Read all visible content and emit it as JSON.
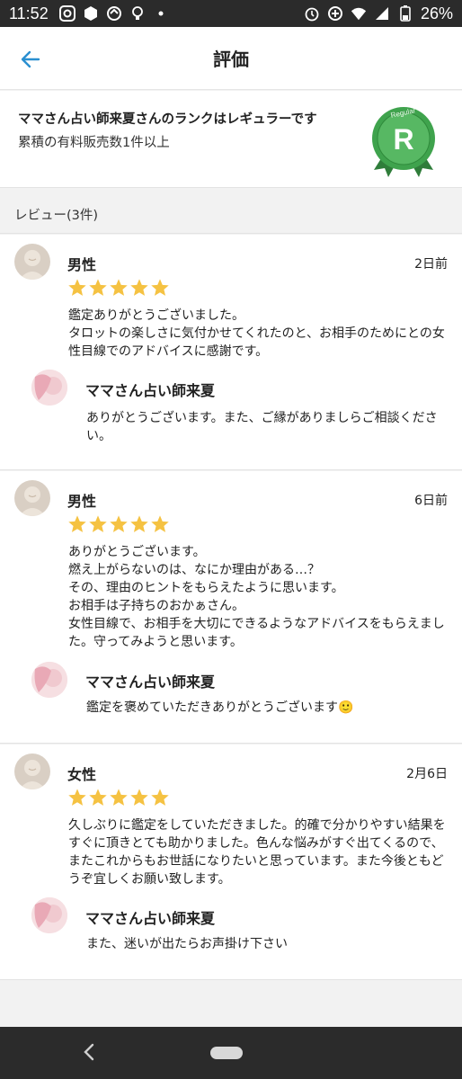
{
  "status_bar": {
    "time": "11:52",
    "battery": "26%"
  },
  "app_bar": {
    "title": "評価",
    "back_icon": "arrow-left-icon"
  },
  "rank": {
    "title": "ママさん占い師来夏さんのランクはレギュラーです",
    "subtitle": "累積の有料販売数1件以上",
    "badge_letter": "R",
    "badge_text": "Regular",
    "badge_color": "#3fa34d"
  },
  "reviews_header": "レビュー(3件)",
  "star_color": "#f5c242",
  "reviews": [
    {
      "gender": "男性",
      "date": "2日前",
      "rating": 5,
      "body": "鑑定ありがとうございました。\nタロットの楽しさに気付かせてくれたのと、お相手のためにとの女性目線でのアドバイスに感謝です。",
      "reply_name": "ママさん占い師来夏",
      "reply_text": "ありがとうございます。また、ご縁がありましらご相談ください。"
    },
    {
      "gender": "男性",
      "date": "6日前",
      "rating": 5,
      "body": "ありがとうございます。\n燃え上がらないのは、なにか理由がある…？\nその、理由のヒントをもらえたように思います。\nお相手は子持ちのおかぁさん。\n女性目線で、お相手を大切にできるようなアドバイスをもらえました。守ってみようと思います。",
      "reply_name": "ママさん占い師来夏",
      "reply_text": "鑑定を褒めていただきありがとうございます🙂"
    },
    {
      "gender": "女性",
      "date": "2月6日",
      "rating": 5,
      "body": "久しぶりに鑑定をしていただきました。的確で分かりやすい結果をすぐに頂きとても助かりました。色んな悩みがすぐ出てくるので、またこれからもお世話になりたいと思っています。また今後ともどうぞ宜しくお願い致します。",
      "reply_name": "ママさん占い師来夏",
      "reply_text": "また、迷いが出たらお声掛け下さい"
    }
  ]
}
